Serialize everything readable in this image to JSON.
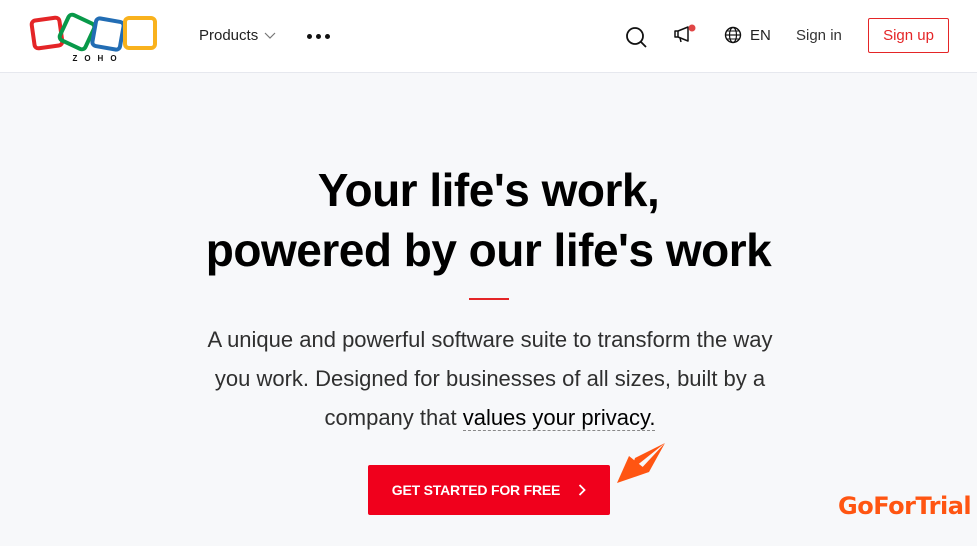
{
  "header": {
    "logo_text": "ZOHO",
    "logo_colors": [
      "#e42527",
      "#089949",
      "#226db4",
      "#f9b21d"
    ],
    "nav": {
      "products_label": "Products",
      "more_icon": "more-horizontal-icon"
    },
    "icons": {
      "search": "search-icon",
      "announcement": "megaphone-icon",
      "language": "globe-icon"
    },
    "language_label": "EN",
    "signin_label": "Sign in",
    "signup_label": "Sign up"
  },
  "hero": {
    "title_line1": "Your life's work,",
    "title_line2": "powered by our life's work",
    "description_text": "A unique and powerful software suite to transform the way you work. Designed for businesses of all sizes, built by a company that ",
    "privacy_link": "values your privacy.",
    "cta_label": "GET STARTED FOR FREE",
    "cta_icon": "chevron-right-icon"
  },
  "annotation": {
    "arrow_icon": "arrow-pointer-icon",
    "watermark": "GoForTrial"
  },
  "colors": {
    "brand_red": "#e42527",
    "cta_red": "#f0001c",
    "annotation_orange": "#ff5512",
    "notification_dot": "#e04545"
  }
}
